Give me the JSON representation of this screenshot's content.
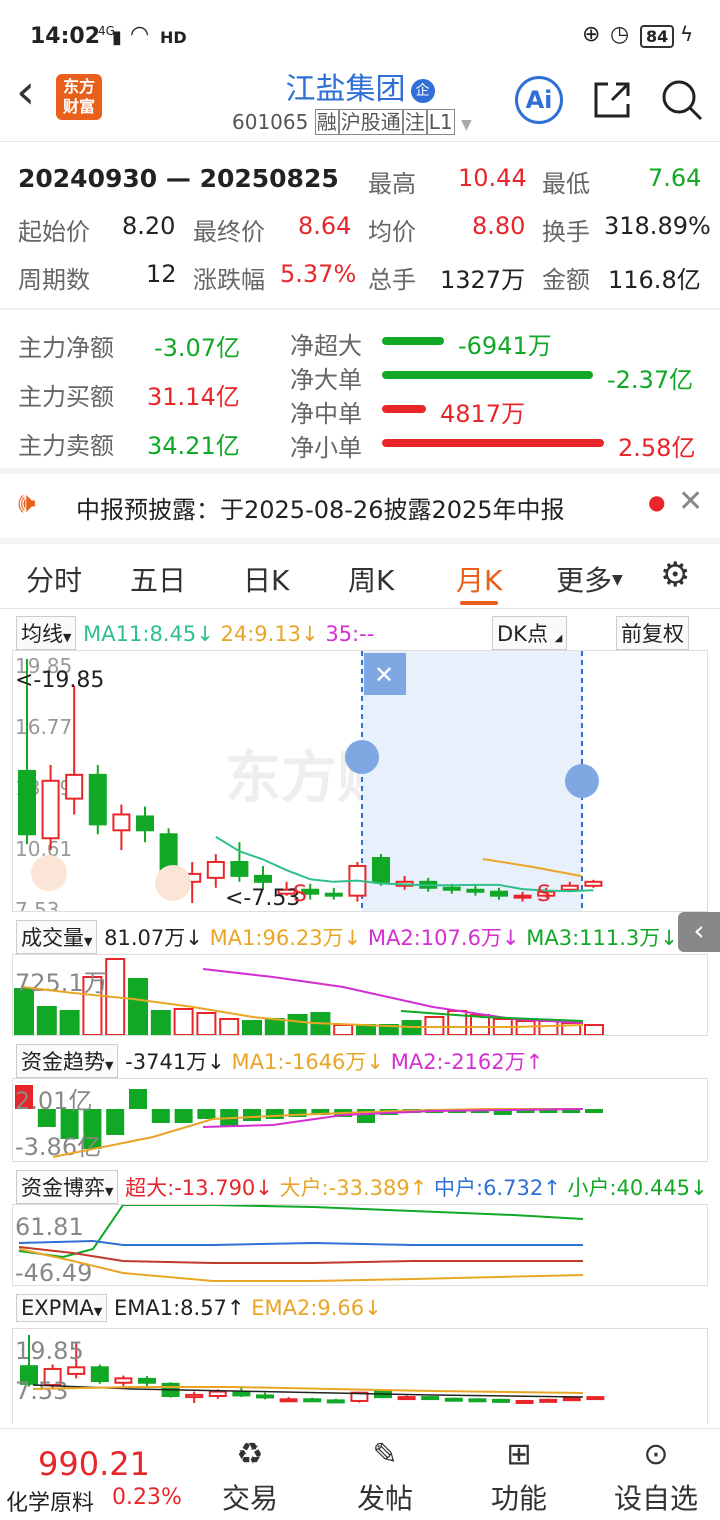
{
  "status_bar": {
    "time": "14:02",
    "network": "4G",
    "hd": "HD",
    "battery": "84"
  },
  "header": {
    "logo_text_1": "东方",
    "logo_text_2": "财富",
    "title": "江盐集团",
    "badge": "企",
    "code": "601065",
    "tags": [
      "融",
      "沪股通",
      "注",
      "L1"
    ],
    "ai_label": "Ai"
  },
  "summary": {
    "period": "20240930 — 20250825",
    "high_label": "最高",
    "high": "10.44",
    "low_label": "最低",
    "low": "7.64",
    "open_label": "起始价",
    "open": "8.20",
    "close_label": "最终价",
    "close": "8.64",
    "avg_label": "均价",
    "avg": "8.80",
    "turnover_label": "换手",
    "turnover": "318.89%",
    "count_label": "周期数",
    "count": "12",
    "change_label": "涨跌幅",
    "change": "5.37%",
    "volume_label": "总手",
    "volume": "1327万",
    "amount_label": "金额",
    "amount": "116.8亿"
  },
  "flow": {
    "net_label": "主力净额",
    "net": "-3.07亿",
    "buy_label": "主力买额",
    "buy": "31.14亿",
    "sell_label": "主力卖额",
    "sell": "34.21亿",
    "bars": [
      {
        "label": "净超大",
        "value": "-6941万",
        "color": "#11a826",
        "frac": 0.28
      },
      {
        "label": "净大单",
        "value": "-2.37亿",
        "color": "#11a826",
        "frac": 0.95
      },
      {
        "label": "净中单",
        "value": "4817万",
        "color": "#e8262a",
        "frac": 0.2
      },
      {
        "label": "净小单",
        "value": "2.58亿",
        "color": "#e8262a",
        "frac": 1.0
      }
    ]
  },
  "notice": {
    "text": "中报预披露：于2025-08-26披露2025年中报"
  },
  "tabs": [
    "分时",
    "五日",
    "日K",
    "周K",
    "月K",
    "更多"
  ],
  "active_tab": "月K",
  "kline": {
    "selector": "均线",
    "ma11": "MA11:8.45↓",
    "ma24": "24:9.13↓",
    "ma35": "35:--",
    "dk": "DK点",
    "adjust": "前复权",
    "y_labels": [
      "19.85",
      "16.77",
      "13.69",
      "10.61",
      "7.53"
    ],
    "max_marker": "<-19.85",
    "min_marker": "<-7.53",
    "watermark": "东方财富",
    "candles": [
      {
        "o": 14.2,
        "c": 11.0,
        "h": 19.85,
        "l": 10.5
      },
      {
        "o": 10.8,
        "c": 13.7,
        "h": 14.5,
        "l": 10.2
      },
      {
        "o": 12.8,
        "c": 14.0,
        "h": 18.5,
        "l": 12.0
      },
      {
        "o": 14.0,
        "c": 11.5,
        "h": 14.5,
        "l": 11.0
      },
      {
        "o": 11.2,
        "c": 12.0,
        "h": 12.5,
        "l": 10.2
      },
      {
        "o": 11.9,
        "c": 11.2,
        "h": 12.4,
        "l": 10.6
      },
      {
        "o": 11.0,
        "c": 8.8,
        "h": 11.3,
        "l": 8.5
      },
      {
        "o": 8.6,
        "c": 9.0,
        "h": 9.6,
        "l": 7.53
      },
      {
        "o": 8.8,
        "c": 9.6,
        "h": 10.0,
        "l": 8.3
      },
      {
        "o": 9.6,
        "c": 8.9,
        "h": 10.6,
        "l": 8.6
      },
      {
        "o": 8.9,
        "c": 8.6,
        "h": 9.4,
        "l": 8.2
      },
      {
        "o": 8.0,
        "c": 8.2,
        "h": 8.6,
        "l": 7.9
      },
      {
        "o": 8.2,
        "c": 8.0,
        "h": 8.5,
        "l": 7.7
      },
      {
        "o": 8.0,
        "c": 7.9,
        "h": 8.3,
        "l": 7.7
      },
      {
        "o": 7.9,
        "c": 9.4,
        "h": 9.6,
        "l": 7.6
      },
      {
        "o": 9.8,
        "c": 8.6,
        "h": 10.0,
        "l": 8.4
      },
      {
        "o": 8.4,
        "c": 8.6,
        "h": 8.9,
        "l": 8.2
      },
      {
        "o": 8.6,
        "c": 8.3,
        "h": 8.8,
        "l": 8.1
      },
      {
        "o": 8.3,
        "c": 8.2,
        "h": 8.5,
        "l": 8.0
      },
      {
        "o": 8.2,
        "c": 8.1,
        "h": 8.4,
        "l": 7.9
      },
      {
        "o": 8.1,
        "c": 7.9,
        "h": 8.3,
        "l": 7.7
      },
      {
        "o": 7.8,
        "c": 7.9,
        "h": 8.1,
        "l": 7.6
      },
      {
        "o": 7.9,
        "c": 8.1,
        "h": 8.3,
        "l": 7.8
      },
      {
        "o": 8.2,
        "c": 8.4,
        "h": 8.6,
        "l": 8.1
      },
      {
        "o": 8.4,
        "c": 8.6,
        "h": 8.7,
        "l": 8.3
      }
    ]
  },
  "volume": {
    "selector": "成交量",
    "value": "81.07万↓",
    "ma1": "MA1:96.23万↓",
    "ma2": "MA2:107.6万↓",
    "ma3": "MA3:111.3万↓",
    "y_label": "725.1万"
  },
  "fund_trend": {
    "selector": "资金趋势",
    "value": "-3741万↓",
    "ma1": "MA1:-1646万↓",
    "ma2": "MA2:-2162万↑",
    "y_top": "2.01亿",
    "y_bottom": "-3.86亿"
  },
  "fund_game": {
    "selector": "资金博弈",
    "super": "超大:-13.790↓",
    "big": "大户:-33.389↑",
    "mid": "中户:6.732↑",
    "small": "小户:40.445↓",
    "y_top": "61.81",
    "y_bottom": "-46.49"
  },
  "expma": {
    "selector": "EXPMA",
    "ema1": "EMA1:8.57↑",
    "ema2": "EMA2:9.66↓",
    "y_top": "19.85",
    "y_bottom": "7.53"
  },
  "bottom_bar": {
    "index_value": "990.21",
    "index_name": "化学原料",
    "index_change": "0.23%",
    "buttons": [
      "交易",
      "发帖",
      "功能",
      "设自选"
    ]
  },
  "colors": {
    "red": "#e8262a",
    "green": "#11a826",
    "blue": "#2f6fd6",
    "orange": "#e9a526",
    "magenta": "#d32fd3"
  }
}
